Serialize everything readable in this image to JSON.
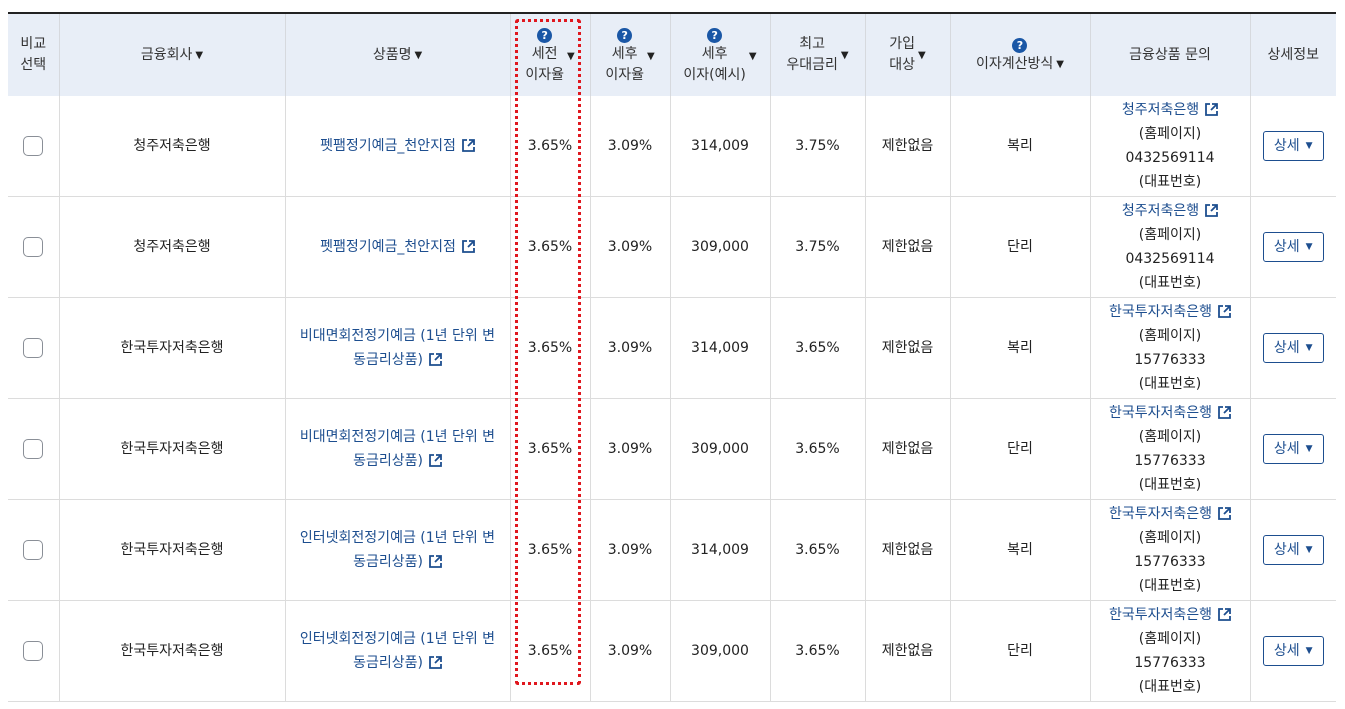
{
  "headers": {
    "compare": [
      "비교",
      "선택"
    ],
    "company": "금융회사",
    "product": "상품명",
    "pretax": [
      "세전",
      "이자율"
    ],
    "aftertax": [
      "세후",
      "이자율"
    ],
    "interest": [
      "세후",
      "이자(예시)"
    ],
    "max_rate": [
      "최고",
      "우대금리"
    ],
    "join": [
      "가입",
      "대상"
    ],
    "calc": "이자계산방식",
    "inquiry": "금융상품 문의",
    "detail": "상세정보"
  },
  "rows": [
    {
      "company": "청주저축은행",
      "product": [
        "펫팸정기예금_천안지점"
      ],
      "pretax": "3.65%",
      "aftertax": "3.09%",
      "interest": "314,009",
      "max_rate": "3.75%",
      "join": "제한없음",
      "calc": "복리",
      "contact_name": "청주저축은행",
      "contact_home": "(홈페이지)",
      "contact_phone": "0432569114",
      "contact_phone_label": "(대표번호)",
      "detail_label": "상세"
    },
    {
      "company": "청주저축은행",
      "product": [
        "펫팸정기예금_천안지점"
      ],
      "pretax": "3.65%",
      "aftertax": "3.09%",
      "interest": "309,000",
      "max_rate": "3.75%",
      "join": "제한없음",
      "calc": "단리",
      "contact_name": "청주저축은행",
      "contact_home": "(홈페이지)",
      "contact_phone": "0432569114",
      "contact_phone_label": "(대표번호)",
      "detail_label": "상세"
    },
    {
      "company": "한국투자저축은행",
      "product": [
        "비대면회전정기예금 (1년 단위 변",
        "동금리상품)"
      ],
      "pretax": "3.65%",
      "aftertax": "3.09%",
      "interest": "314,009",
      "max_rate": "3.65%",
      "join": "제한없음",
      "calc": "복리",
      "contact_name": "한국투자저축은행",
      "contact_home": "(홈페이지)",
      "contact_phone": "15776333",
      "contact_phone_label": "(대표번호)",
      "detail_label": "상세"
    },
    {
      "company": "한국투자저축은행",
      "product": [
        "비대면회전정기예금 (1년 단위 변",
        "동금리상품)"
      ],
      "pretax": "3.65%",
      "aftertax": "3.09%",
      "interest": "309,000",
      "max_rate": "3.65%",
      "join": "제한없음",
      "calc": "단리",
      "contact_name": "한국투자저축은행",
      "contact_home": "(홈페이지)",
      "contact_phone": "15776333",
      "contact_phone_label": "(대표번호)",
      "detail_label": "상세"
    },
    {
      "company": "한국투자저축은행",
      "product": [
        "인터넷회전정기예금 (1년 단위 변",
        "동금리상품)"
      ],
      "pretax": "3.65%",
      "aftertax": "3.09%",
      "interest": "314,009",
      "max_rate": "3.65%",
      "join": "제한없음",
      "calc": "복리",
      "contact_name": "한국투자저축은행",
      "contact_home": "(홈페이지)",
      "contact_phone": "15776333",
      "contact_phone_label": "(대표번호)",
      "detail_label": "상세"
    },
    {
      "company": "한국투자저축은행",
      "product": [
        "인터넷회전정기예금 (1년 단위 변",
        "동금리상품)"
      ],
      "pretax": "3.65%",
      "aftertax": "3.09%",
      "interest": "309,000",
      "max_rate": "3.65%",
      "join": "제한없음",
      "calc": "단리",
      "contact_name": "한국투자저축은행",
      "contact_home": "(홈페이지)",
      "contact_phone": "15776333",
      "contact_phone_label": "(대표번호)",
      "detail_label": "상세"
    }
  ],
  "icons": {
    "help": "question-circle-icon",
    "sort": "sort-down-icon",
    "external": "external-link-icon",
    "dropdown": "chevron-down-icon"
  },
  "colors": {
    "link": "#1d4e8f",
    "header_bg": "#e8eef7",
    "help_icon": "#1a57a6",
    "highlight": "#e0171e"
  }
}
